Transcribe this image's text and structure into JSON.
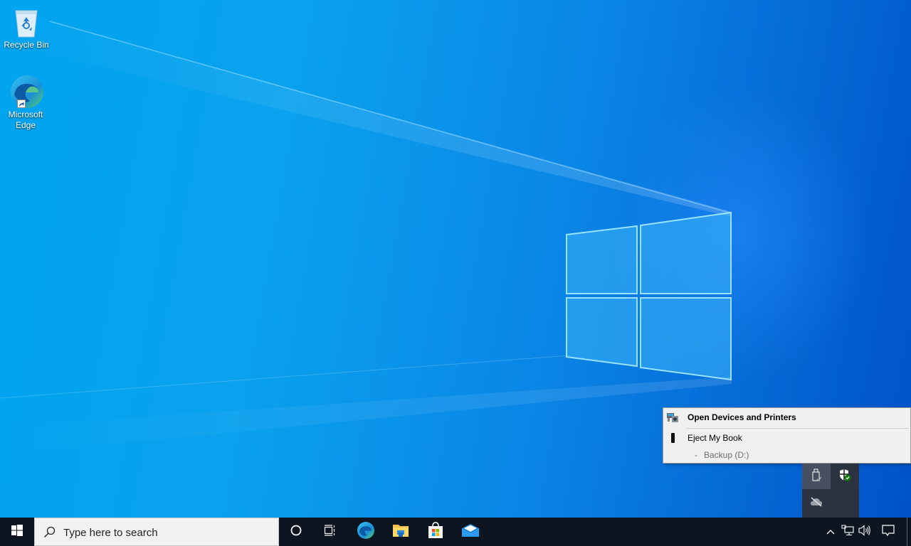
{
  "desktop": {
    "icons": [
      {
        "label": "Recycle Bin",
        "icon": "recycle-bin-icon"
      },
      {
        "label_line1": "Microsoft",
        "label_line2": "Edge",
        "icon": "edge-icon",
        "shortcut": true
      }
    ]
  },
  "context_menu": {
    "items": [
      {
        "label": "Open Devices and Printers",
        "icon": "devices-printers-icon",
        "bold": true
      },
      {
        "label": "Eject My Book",
        "icon": "usb-drive-icon"
      }
    ],
    "sub_item": {
      "prefix": "-",
      "label": "Backup (D:)"
    }
  },
  "tray_flyout": {
    "icons": [
      "safely-remove-hardware-icon",
      "windows-security-icon",
      "onedrive-offline-icon"
    ]
  },
  "taskbar": {
    "search_placeholder": "Type here to search",
    "pinned": [
      "cortana-icon",
      "task-view-icon",
      "edge-icon",
      "file-explorer-icon",
      "microsoft-store-icon",
      "mail-icon"
    ],
    "tray": [
      "show-hidden-icons",
      "network-icon",
      "volume-icon",
      "action-center-icon"
    ]
  },
  "colors": {
    "taskbar": "#0d1520",
    "flyout": "#2b3340",
    "menu_bg": "#f0f0f0",
    "accent": "#0078d7",
    "security_green": "#107c10"
  }
}
